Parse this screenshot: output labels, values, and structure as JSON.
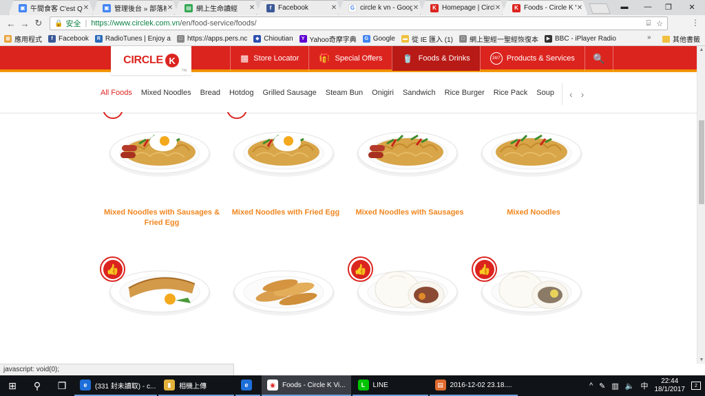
{
  "browser": {
    "tabs": [
      {
        "title": "午間食客 C'est Qu",
        "favicon_color": "#4285f4",
        "favicon_glyph": "▣",
        "active": false
      },
      {
        "title": "管理後台 » 部落格",
        "favicon_color": "#4285f4",
        "favicon_glyph": "▣",
        "active": false
      },
      {
        "title": "網上生命讀經",
        "favicon_color": "#34a853",
        "favicon_glyph": "▤",
        "active": false
      },
      {
        "title": "Facebook",
        "favicon_color": "#3b5998",
        "favicon_glyph": "f",
        "active": false
      },
      {
        "title": "circle k vn - Goog",
        "favicon_color": "#ffffff",
        "favicon_glyph": "G",
        "active": false
      },
      {
        "title": "Homepage | Circl",
        "favicon_color": "#dc241f",
        "favicon_glyph": "K",
        "active": false
      },
      {
        "title": "Foods - Circle K V",
        "favicon_color": "#dc241f",
        "favicon_glyph": "K",
        "active": true
      }
    ],
    "secure_label": "安全",
    "url_host": "https://www.circlek.com.vn",
    "url_path": "/en/food-service/foods/",
    "bookmarks": [
      {
        "label": "應用程式",
        "icon_color": "#e8a33b",
        "glyph": "▦"
      },
      {
        "label": "Facebook",
        "icon_color": "#3b5998",
        "glyph": "f"
      },
      {
        "label": "RadioTunes | Enjoy a",
        "icon_color": "#2a6ab8",
        "glyph": "R"
      },
      {
        "label": "https://apps.pers.nc",
        "icon_color": "#888888",
        "glyph": "□"
      },
      {
        "label": "Chioutian",
        "icon_color": "#2d4fb0",
        "glyph": "◆"
      },
      {
        "label": "Yahoo奇摩字典",
        "icon_color": "#5f01d1",
        "glyph": "Y"
      },
      {
        "label": "Google",
        "icon_color": "#4285f4",
        "glyph": "G"
      },
      {
        "label": "從 IE 匯入 (1)",
        "icon_color": "#f0c040",
        "glyph": "▬"
      },
      {
        "label": "網上聖經一聖經恢復本",
        "icon_color": "#888888",
        "glyph": "□"
      },
      {
        "label": "BBC - iPlayer Radio",
        "icon_color": "#333333",
        "glyph": "▶"
      }
    ],
    "bookmarks_more": "»",
    "other_bookmarks": "其他書籤",
    "status_text": "javascript: void(0);"
  },
  "site": {
    "logo_text": "CIRCLE",
    "logo_k": "K",
    "logo_tm": "TM",
    "nav": [
      {
        "label": "Store Locator",
        "icon": "store-icon",
        "glyph": "▦",
        "active": false
      },
      {
        "label": "Special Offers",
        "icon": "gift-icon",
        "glyph": "🎁",
        "active": false
      },
      {
        "label": "Foods & Drinks",
        "icon": "cup-icon",
        "glyph": "🥤",
        "active": true
      },
      {
        "label": "Products & Services",
        "icon": "24-7-icon",
        "glyph": "24/7",
        "active": false
      }
    ],
    "search_glyph": "🔍",
    "categories": [
      "All Foods",
      "Mixed Noodles",
      "Bread",
      "Hotdog",
      "Grilled Sausage",
      "Steam Bun",
      "Onigiri",
      "Sandwich",
      "Rice Burger",
      "Rice Pack",
      "Soup"
    ],
    "active_category": "All Foods",
    "brand_colors": {
      "red": "#dc241f",
      "orange": "#f29200",
      "product_text": "#f0861f"
    }
  },
  "products": [
    {
      "name": "Mixed Noodles with Sausages & Fried Egg",
      "image": "noodles-sausage-egg",
      "badge": true
    },
    {
      "name": "Mixed Noodles with Fried Egg",
      "image": "noodles-egg",
      "badge": true
    },
    {
      "name": "Mixed Noodles with Sausages",
      "image": "noodles-sausage",
      "badge": false
    },
    {
      "name": "Mixed Noodles",
      "image": "noodles-plain",
      "badge": false
    },
    {
      "name": "",
      "image": "banh-mi-egg",
      "badge": true
    },
    {
      "name": "",
      "image": "bread-rolls",
      "badge": false
    },
    {
      "name": "",
      "image": "steam-bun",
      "badge": true
    },
    {
      "name": "",
      "image": "steam-bun-egg",
      "badge": true
    }
  ],
  "taskbar": {
    "apps": [
      {
        "label": "(331 封未讀取) - c...",
        "icon_color": "#1e6fd9",
        "glyph": "e",
        "active": false
      },
      {
        "label": "相機上傳",
        "icon_color": "#e3b23c",
        "glyph": "▮",
        "active": false
      },
      {
        "label": "",
        "icon_color": "#1e6fd9",
        "glyph": "e",
        "active": false
      },
      {
        "label": "Foods - Circle K Vi...",
        "icon_color": "#ffffff",
        "glyph": "◉",
        "active": true
      },
      {
        "label": "LINE",
        "icon_color": "#00c300",
        "glyph": "L",
        "active": false
      },
      {
        "label": "2016-12-02 23.18....",
        "icon_color": "#e06a2e",
        "glyph": "▤",
        "active": false
      }
    ],
    "time": "22:44",
    "date": "18/1/2017",
    "notification_count": "2"
  }
}
